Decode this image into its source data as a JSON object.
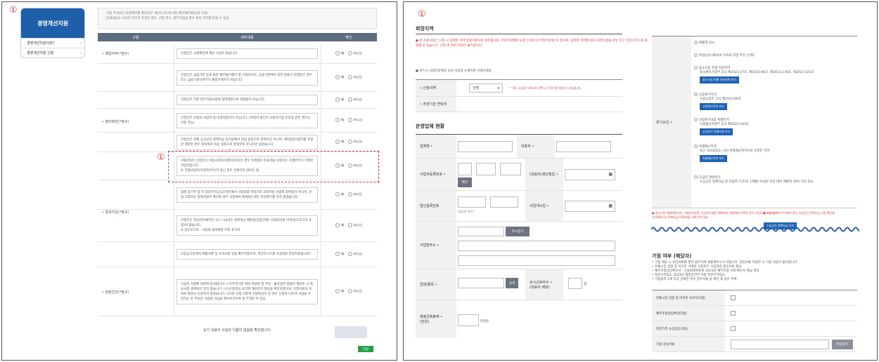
{
  "badge": "①",
  "left": {
    "sidebar": {
      "title": "경영개선지원",
      "items": [
        {
          "label": "경영개선지원이란?",
          "arrow": "›"
        },
        {
          "label": "경영개선지원 신청",
          "arrow": "›"
        }
      ]
    },
    "notice": [
      "· 가점 자격요건 안정여부를 확인하고 '예/아니오'에 V를 체크해주세요(필 가정)",
      "· 안내내용이 사실과 다르게 작성된 경우, 선정 취소, 정부지원금 환수 등의 조치를 받을 수 있음"
    ],
    "table": {
      "headers": [
        "구분",
        "세부내용",
        "확인"
      ],
      "yes": "예",
      "no": "아니오",
      "categories": [
        "• 폐업여부(*필수)",
        "• 참여제한(*필수)",
        "• 중복지원(*필수)",
        "• 정량진단(*필수)"
      ],
      "rows": [
        "신청인은 국세체납에 해당 사실이 없습니다.",
        "신청인은 금융기관 등을 통한 채무불이행이 될 사항이거나, 금융기관에서 대한 압류가 진행중인 경우 또는 금융기관으로부터 불량거래처가 아닙니다.",
        "신청인은 다른 정부지원사업에 참여제한으로 제재중이 아닙니다.",
        "신청인은 보령의 사업자 및 비영리법인이 아닙니다. (비영리 법인이 사회적기업 인증을 받은 경우는 신청 가능)",
        "신청인은 현재 소상공인 정책자금 등지원에서 대상 업종으로 영위하고 아니며, 제5창업사업자를 포함한 제한된 경우 중지에서 대상 업종으로 창업한지 아니라인 되었습니다.",
        "(해당자만) 신청인이 가업사업자(프랜차이즈)인 경우 가맹점의 목표성을 인정하는 가맹본부가 가맹된 사업자입니다.\n※ 가맹사업자(프랜차이즈)가 아닌 경우 선택하지 않아도 됨",
        "답해 중기부 및 타 중앙부처(공공기관)에서 사업화를 목적으로 국비지원 사업에 참여중이 아니며, 선정 이후라도 중복지원이 확인될 경우 사업에서 배제되는데도 이의제기를 하지 않겠습니다.",
        "신청인은 희망리턴패키지 '23~'24년도 경영개선·재창업(업종전환) 사업화지원 이력(중도포기자 포함)이 없습니다.\n※ 중도포기자 : 사업화 협약체결 이후 포기자",
        "모집공고문에서 제출서류 및 유의사항 등을 확인하였으며, 제크리스트를 사실대로 작성하였습니까?",
        "나중의 사항에 대하여 동의합니다: (가)주관기관 위탁 위원회 및 부당 · 불성실한 방법이 재검토 시 필요사항 생략되어 있지 않습니다. (나)신청자의 요건에 해당하지 않음을 확인하였으며, 신청자료의 이외로 발견시 신청하지 않겠습니다. (다)본 신청 이후에 지원대상이 된 경우 신청과 다르게 사업을 추진하는 등 부당한 사업화 자금을 환수조치하며 총 부과된 수 있음."
      ],
      "footer_text": "상기 내용이 사실과 다름이 없음을 확인합니다.",
      "save_label": "저장"
    }
  },
  "right": {
    "section1_title": "희망지역",
    "red_notice": "● 본 지원사업은 신청 시 입력한 지역 업장기준으로 검토합니다. 주관기관별로 모집 인원이 조기에 마감될 수 있으며, 입력한 지역에 접수기관이 없을 경우 인근 주관기관으로 배정될 수 있습니다. 신청 후 지역 변경은 불가합니다.",
    "hint": "● 반드시 사업자등록증 상의 사업장 소재지로 선택하세요.",
    "region_label": "• 신청지역",
    "region_select": "선택",
    "region_note": "* 지도 사업장 지역으로 선택 시 주관기관 정보가 나타납니다.",
    "agency_label": "• 주관기관 연락처",
    "section2_title": "운영업체 현황",
    "form": {
      "company_label": "업체명 •",
      "ceo_label": "대표자 •",
      "bizno_label": "사업자등록번호 •",
      "confirm_btn": "확인",
      "ceo_birth_label": "(대표자)생년월일 •",
      "corpno_label": "법인등록번호",
      "corpno_hint": "(법인인 경우)",
      "opendate_label": "사업개시일 •",
      "address_label": "사업장주소 •",
      "address_btn": "주소찾기",
      "industry_label": "업태/종목 •",
      "search_btn": "검색",
      "workers_label": "상시근로자수 •",
      "workers_sub": "(대표자 제외)",
      "workers_unit": "명",
      "sales_label": "월평균매출액 •",
      "sales_sub": "(만원)",
      "sales_unit": "(만원)"
    },
    "side_label": "위기요건 •",
    "options": [
      {
        "text": "매출액 감소",
        "sub": ""
      },
      {
        "text": "취업(장소)에서의 가속화 지정 지역 (선택)",
        "sub": ""
      },
      {
        "text": "중소기업 특별 지원지역",
        "sub": "중소벤처기업부 고시 제2023-27호, 제2023-86호, 제2023-236호, 제2023-321호",
        "btn": "중소기업 특별 지원지역 보기"
      },
      {
        "text": "고용위기지역",
        "sub": "고용노동부 고시 제2023-80호",
        "btn": "고용위기지역 보기"
      },
      {
        "text": "산업위기대응 특별지역",
        "sub": "산업통상자원부 공고 제2023-183호",
        "btn": "산업위기 특별지역 보기"
      },
      {
        "text": "특별재난지역",
        "sub": "최근 3년(2021~23) 특별재난지역으로 선포된 지역",
        "btn": "특별재난지역 보기"
      },
      {
        "text": "고금리 경영위기",
        "sub": "소상공인 정책자금 중 이용한 기간(이 1개월) 이내의 전년 대비 매출액 20% 이상 감소",
        "btn": ""
      }
    ],
    "red_notes": [
      "● 중소기업 특별지원지역, 고용위기지역, 산업위기대응 특별지역, 특별재난지역의 경우 사업장 주소지 기준",
      "● 고금리, 저이이익자의 경우 소상공인 정책자금 선정 확인필",
      "  (자료확인시) 정책자금(직접대출) 이용이력 필요"
    ],
    "small_btn": "소상공인 정책자금 보기",
    "section3_title": "가점 여부 (해당자)",
    "gnotes": [
      "• 가점 해당 시 증빙서류를 필히 첨부하여 제출해주시기 바랍니다. 증빙서류 미첨부 시 가점 적용이 불가합니다.",
      "• 전통시장 입점 및 이어진 거래한 신청분은 시장관련 증빙서류 필요",
      "• 채무조정상담확인서 : 신용회복위원회 2023년 채무조정 이력 확인서 발급 필요",
      "• 착한가격업소 2023년 행정안전부 지정 착한가격업소",
      "• 가점항목 2개 이상 선택한 경우 첨부서류 등 확인 후 점수 부여"
    ],
    "checks": [
      "전통시장 입점 및 이어진 보유자(3점)",
      "채무조정상담확인(5점)",
      "착한가격 소상공인(3점)"
    ],
    "attach_label": "가점 증빙서류",
    "attach_btn": "파일찾기"
  }
}
